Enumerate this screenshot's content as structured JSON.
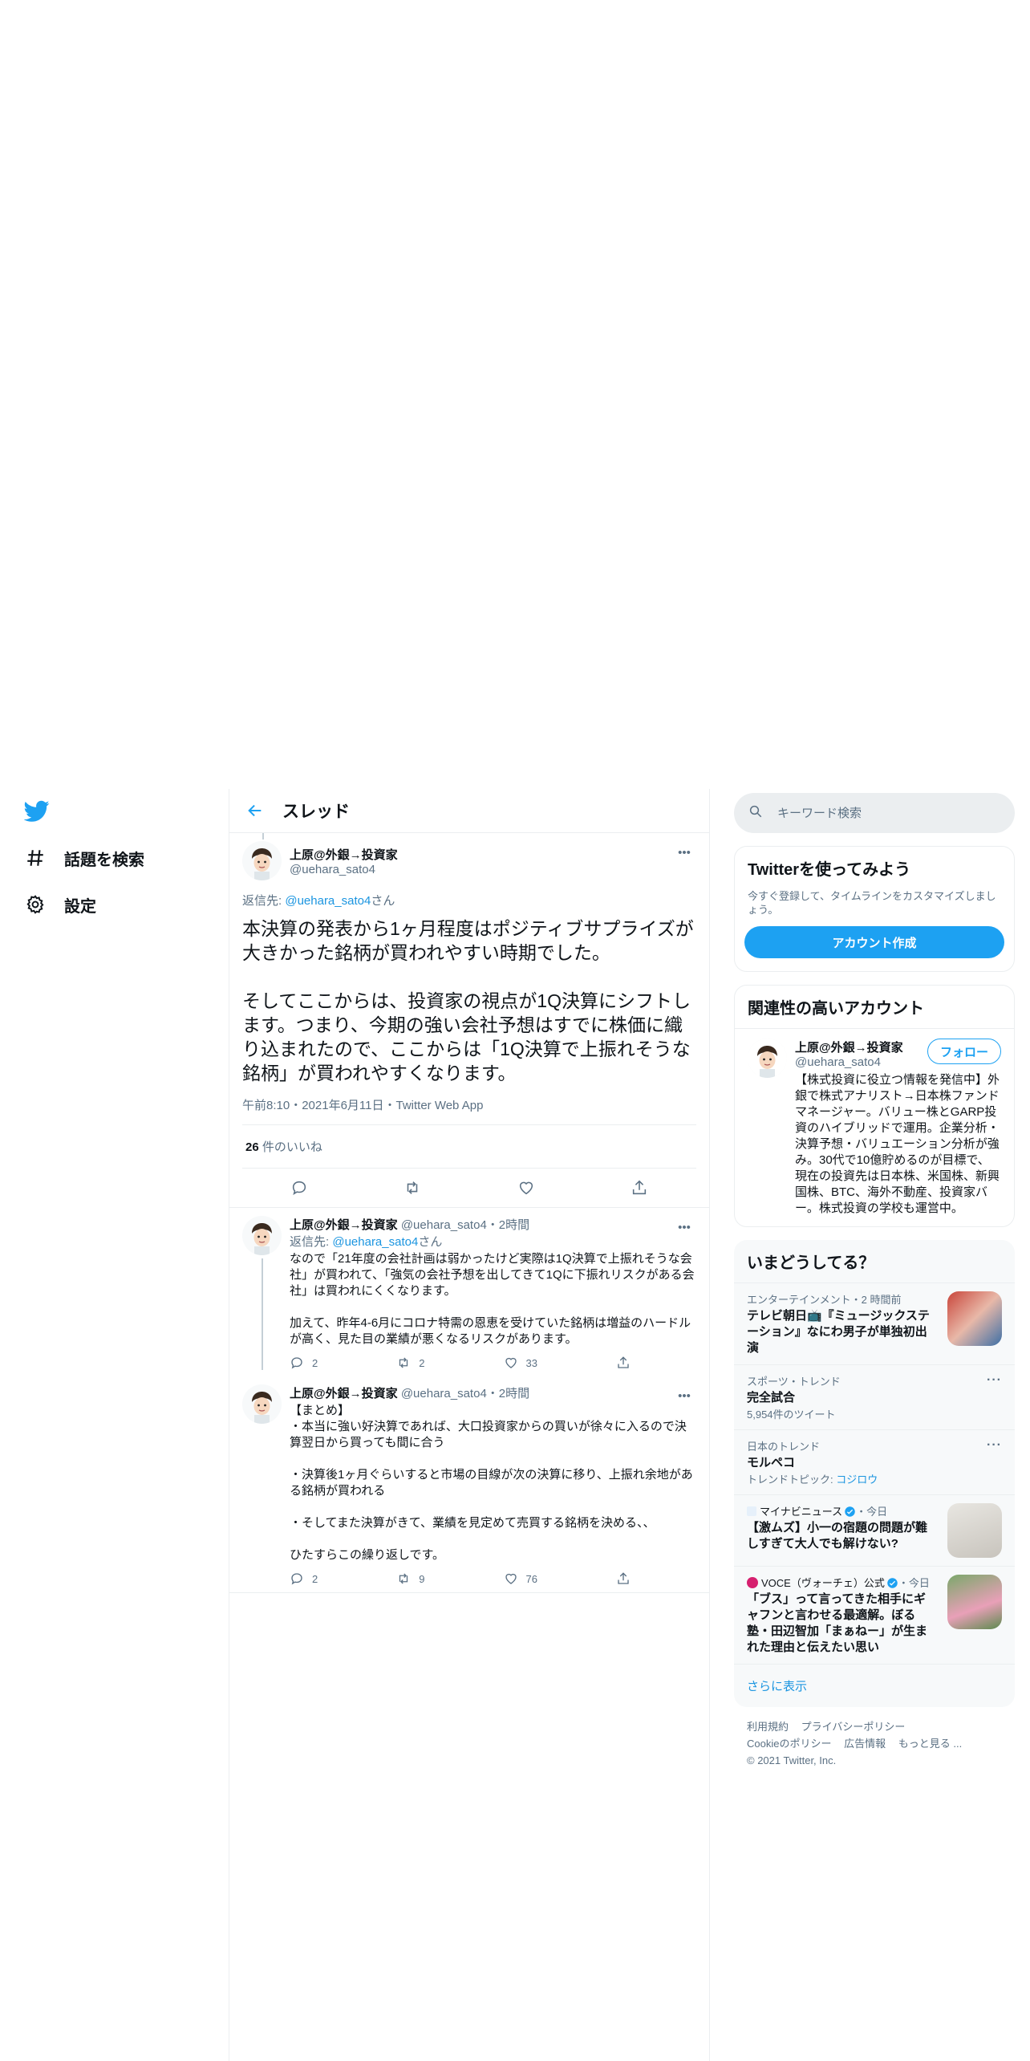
{
  "nav": {
    "explore_label": "話題を検索",
    "settings_label": "設定"
  },
  "header": {
    "title": "スレッド"
  },
  "focus_tweet": {
    "display_name": "上原@外銀→投資家",
    "handle": "@uehara_sato4",
    "reply_prefix": "返信先: ",
    "reply_to": "@uehara_sato4",
    "reply_suffix": "さん",
    "text": "本決算の発表から1ヶ月程度はポジティブサプライズが大きかった銘柄が買われやすい時期でした。\n\nそしてここからは、投資家の視点が1Q決算にシフトします。つまり、今期の強い会社予想はすでに株価に織り込まれたので、ここからは「1Q決算で上振れそうな銘柄」が買われやすくなります。",
    "meta": "午前8:10・2021年6月11日・Twitter Web App",
    "likes_count": "26",
    "likes_label": " 件のいいね"
  },
  "replies": [
    {
      "display_name": "上原@外銀→投資家",
      "handle": "@uehara_sato4",
      "time": "・2時間",
      "reply_prefix": "返信先: ",
      "reply_to": "@uehara_sato4",
      "reply_suffix": "さん",
      "text": "なので「21年度の会社計画は弱かったけど実際は1Q決算で上振れそうな会社」が買われて、「強気の会社予想を出してきて1Qに下振れリスクがある会社」は買われにくくなります。\n\n加えて、昨年4-6月にコロナ特需の恩恵を受けていた銘柄は増益のハードルが高く、見た目の業績が悪くなるリスクがあります。",
      "replies": "2",
      "retweets": "2",
      "likes": "33"
    },
    {
      "display_name": "上原@外銀→投資家",
      "handle": "@uehara_sato4",
      "time": "・2時間",
      "text": "【まとめ】\n・本当に強い好決算であれば、大口投資家からの買いが徐々に入るので決算翌日から買っても間に合う\n\n・決算後1ヶ月ぐらいすると市場の目線が次の決算に移り、上振れ余地がある銘柄が買われる\n\n・そしてまた決算がきて、業績を見定めて売買する銘柄を決める、、\n\nひたすらこの繰り返しです。",
      "replies": "2",
      "retweets": "9",
      "likes": "76"
    }
  ],
  "search": {
    "placeholder": "キーワード検索"
  },
  "cta": {
    "title": "Twitterを使ってみよう",
    "subtitle": "今すぐ登録して、タイムラインをカスタマイズしましょう。",
    "button": "アカウント作成"
  },
  "related": {
    "title": "関連性の高いアカウント",
    "display_name": "上原@外銀→投資家",
    "handle": "@uehara_sato4",
    "follow": "フォロー",
    "bio": "【株式投資に役立つ情報を発信中】外銀で株式アナリスト→日本株ファンドマネージャー。バリュー株とGARP投資のハイブリッドで運用。企業分析・決算予想・バリュエーション分析が強み。30代で10億貯めるのが目標で、現在の投資先は日本株、米国株、新興国株、BTC、海外不動産、投資家バー。株式投資の学校も運営中。"
  },
  "trends": {
    "title": "いまどうしてる？",
    "items": [
      {
        "meta": "エンターテインメント・2 時間前",
        "title": "テレビ朝日📺『ミュージックステーション』なにわ男子が単独初出演",
        "sub": ""
      },
      {
        "meta": "スポーツ・トレンド",
        "title": "完全試合",
        "sub": "5,954件のツイート"
      },
      {
        "meta": "日本のトレンド",
        "title": "モルペコ",
        "sub_prefix": "トレンドトピック: ",
        "sub_link": "コジロウ"
      },
      {
        "source": "マイナビニュース",
        "when": "・今日",
        "title": "【激ムズ】小一の宿題の問題が難しすぎて大人でも解けない?"
      },
      {
        "source": "VOCE（ヴォーチェ）公式",
        "when": "・今日",
        "title": "「ブス」って言ってきた相手にギャフンと言わせる最適解。ぼる塾・田辺智加「まぁねー」が生まれた理由と伝えたい思い"
      }
    ],
    "show_more": "さらに表示"
  },
  "footer": {
    "terms": "利用規約",
    "privacy": "プライバシーポリシー",
    "cookies": "Cookieのポリシー",
    "ads": "広告情報",
    "more": "もっと見る ...",
    "copyright": "© 2021 Twitter, Inc."
  },
  "colors": {
    "accent": "#1da1f2",
    "link": "#1b95e0",
    "secondary_text": "#5b7083",
    "border": "#ebeef0"
  }
}
